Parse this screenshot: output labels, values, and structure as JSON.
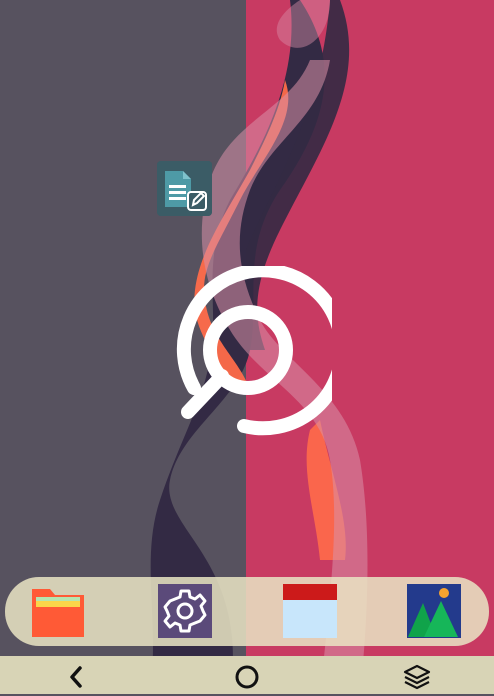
{
  "screen": {
    "name": "android-home-screen"
  },
  "wallpaper": {
    "colors": {
      "background": "#57525f",
      "strip": "#c83a62",
      "dark_wave": "#332a44",
      "orange": "#ff6b4a",
      "light_wave": "#d88fa8"
    }
  },
  "desktop": {
    "icons": [
      {
        "name": "notes-app",
        "icon": "document-edit-icon",
        "color": "#3b5c66"
      }
    ]
  },
  "center_logo": {
    "icon": "search-magnifier-logo",
    "color": "#ffffff"
  },
  "dock": {
    "apps": [
      {
        "name": "files",
        "icon": "folder-icon",
        "color": "#ff5a36"
      },
      {
        "name": "settings",
        "icon": "gear-icon",
        "color": "#5b4a7a"
      },
      {
        "name": "calendar",
        "icon": "calendar-icon",
        "color": "#c8e6fb"
      },
      {
        "name": "gallery",
        "icon": "mountain-picture-icon",
        "color": "#233a8c"
      }
    ]
  },
  "navbar": {
    "buttons": [
      {
        "name": "back",
        "icon": "chevron-left-icon"
      },
      {
        "name": "home",
        "icon": "circle-icon"
      },
      {
        "name": "recents",
        "icon": "layers-icon"
      }
    ]
  }
}
